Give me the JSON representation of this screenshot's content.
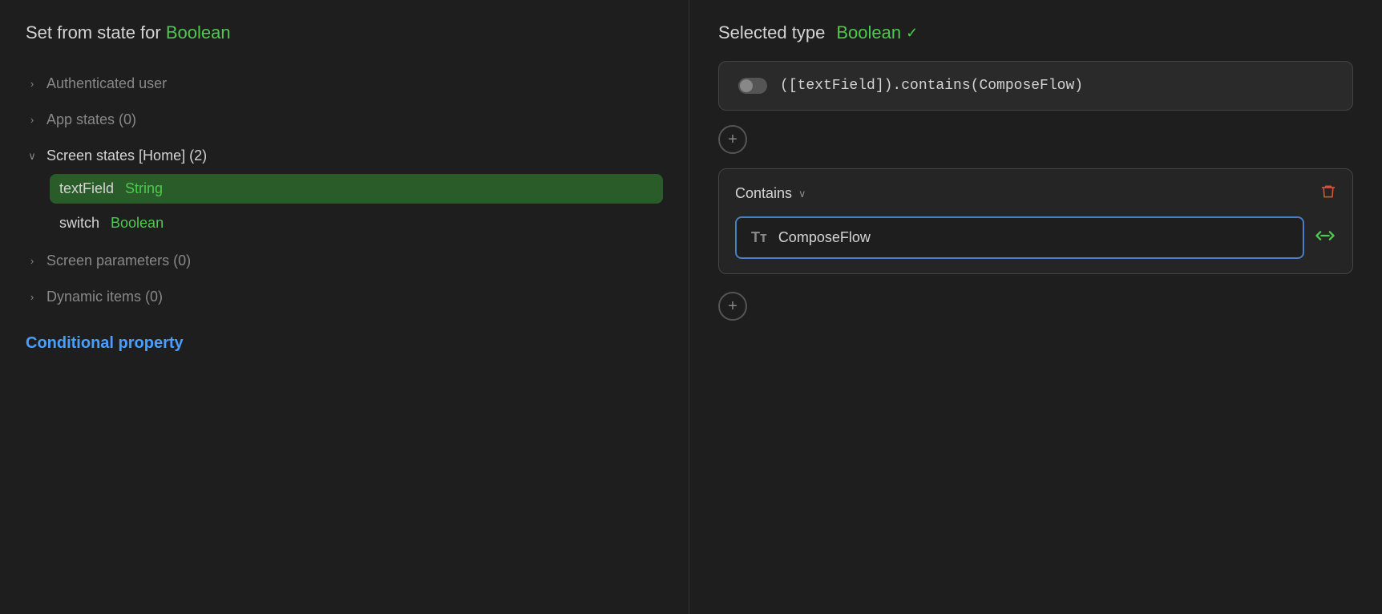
{
  "leftPanel": {
    "title": "Set from state for ",
    "titleType": "Boolean",
    "items": [
      {
        "id": "authenticated-user",
        "label": "Authenticated user",
        "expanded": false,
        "chevron": "›"
      },
      {
        "id": "app-states",
        "label": "App states (0)",
        "expanded": false,
        "chevron": "›"
      },
      {
        "id": "screen-states",
        "label": "Screen states [Home] (2)",
        "expanded": true,
        "chevron": "∨",
        "children": [
          {
            "name": "textField",
            "type": "String",
            "active": true
          },
          {
            "name": "switch",
            "type": "Boolean",
            "active": false
          }
        ]
      },
      {
        "id": "screen-parameters",
        "label": "Screen parameters (0)",
        "expanded": false,
        "chevron": "›"
      },
      {
        "id": "dynamic-items",
        "label": "Dynamic items (0)",
        "expanded": false,
        "chevron": "›"
      }
    ],
    "conditionalProperty": "Conditional property"
  },
  "rightPanel": {
    "selectedTypeLabel": "Selected type",
    "selectedTypeValue": "Boolean",
    "checkMark": "✓",
    "expressionText": "([textField]).contains(ComposeFlow)",
    "addButtonLabel": "+",
    "conditionDropdownLabel": "Contains",
    "conditionChevron": "∨",
    "deleteIcon": "🗑",
    "ttIcon": "Tт",
    "valueText": "ComposeFlow",
    "bindIcon": "⇌",
    "addButtonBottomLabel": "+"
  }
}
